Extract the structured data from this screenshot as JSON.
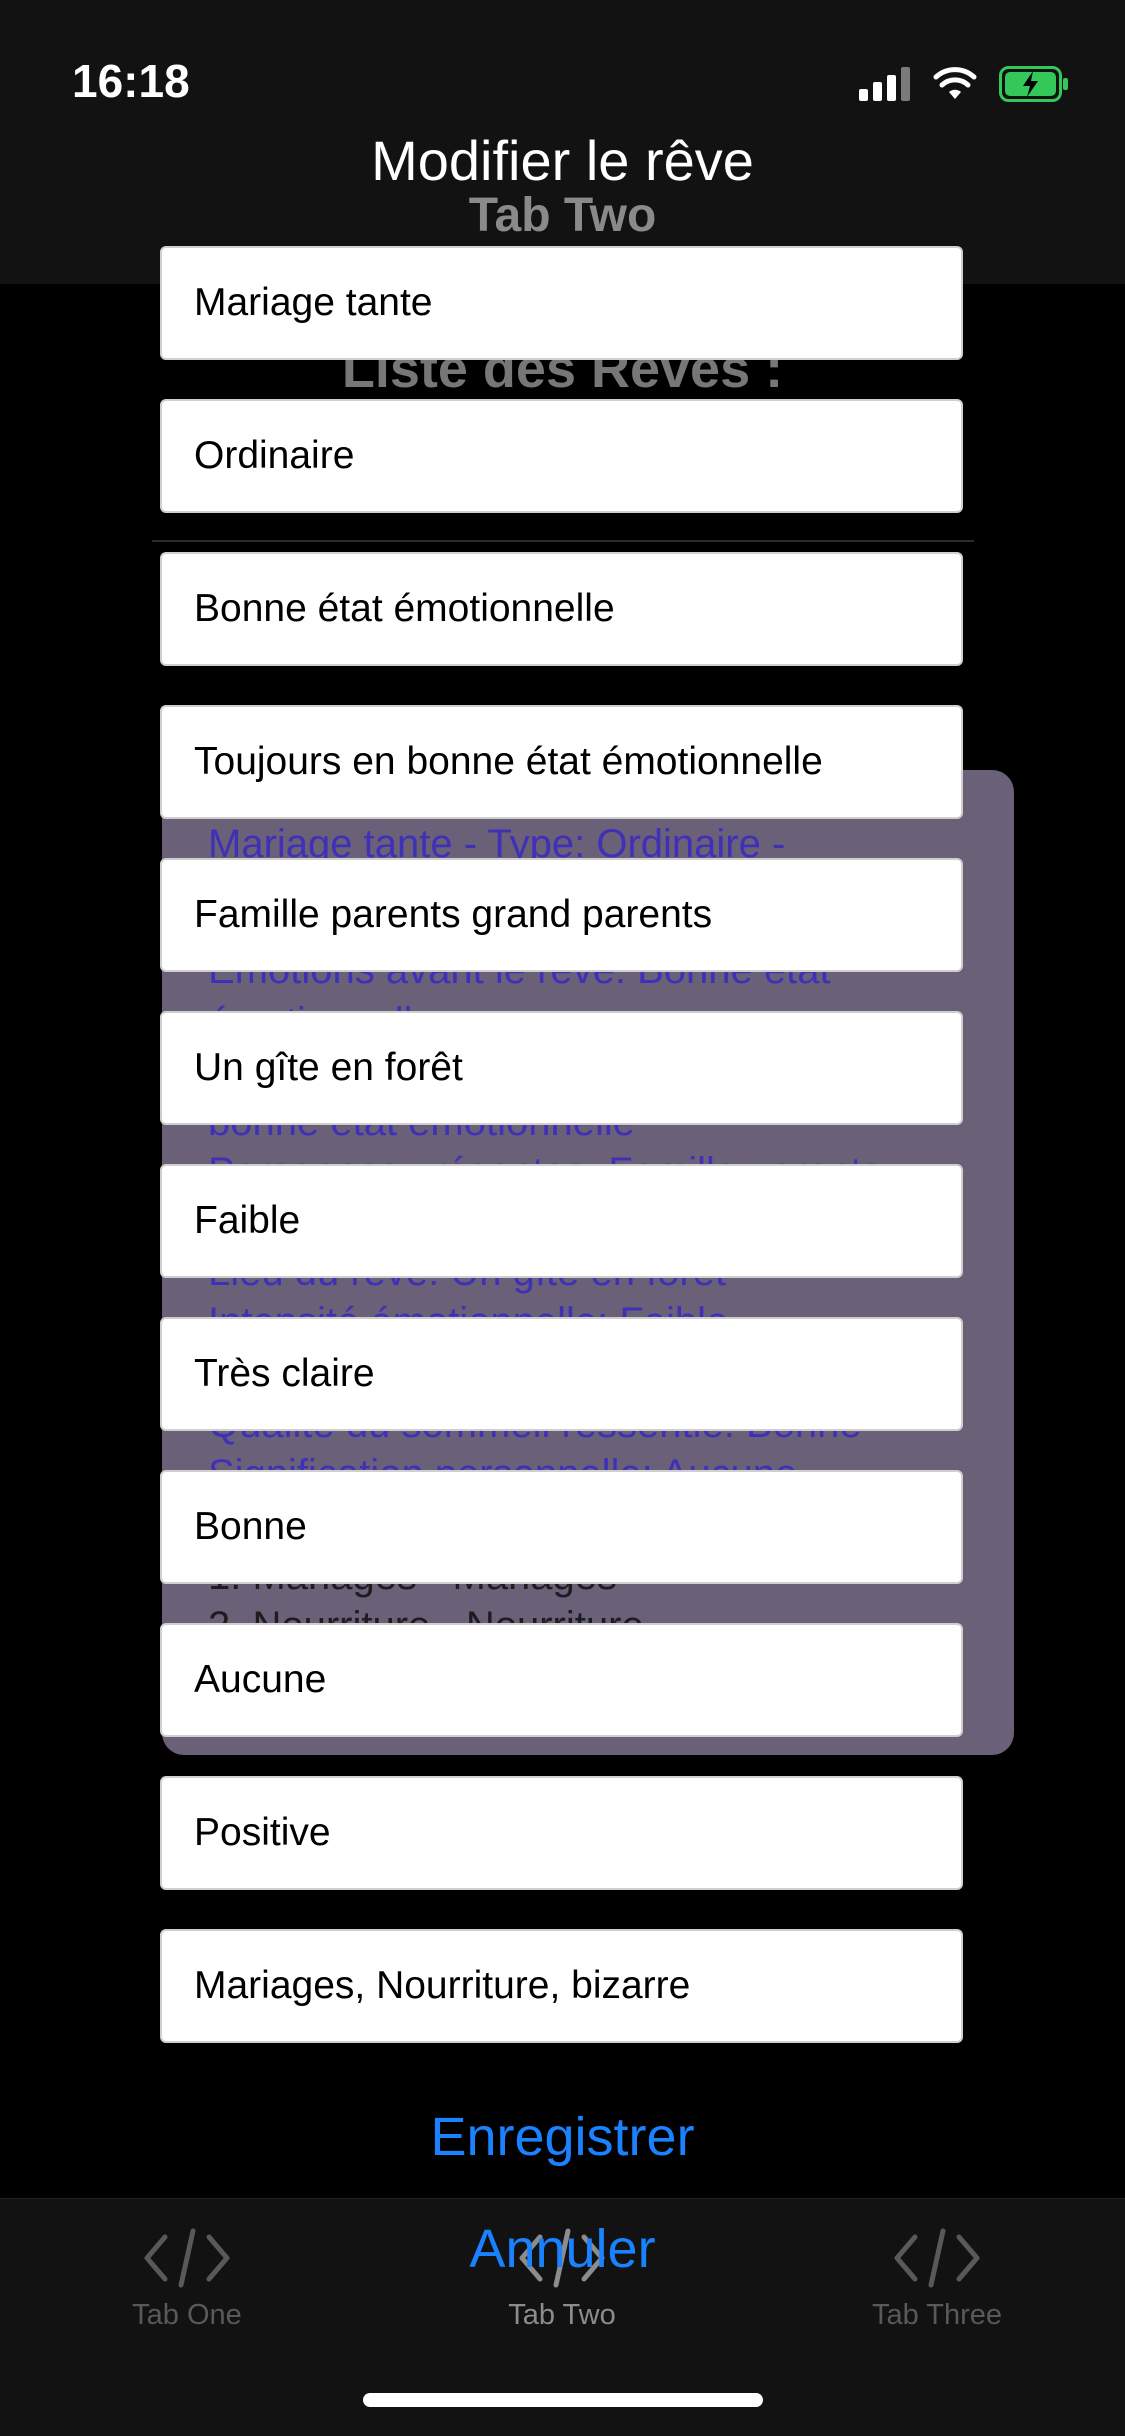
{
  "status_bar": {
    "time": "16:18"
  },
  "modal": {
    "title": "Modifier le rêve",
    "fields": [
      "Mariage tante",
      "Ordinaire",
      "Bonne état émotionnelle",
      "Toujours en bonne état émotionnelle",
      "Famille parents grand parents",
      "Un gîte en forêt",
      "Faible",
      "Très claire",
      "Bonne",
      "Aucune",
      "Positive",
      "Mariages, Nourriture, bizarre"
    ],
    "save_label": "Enregistrer",
    "cancel_label": "Annuler"
  },
  "background_page": {
    "nav_title": "Tab Two",
    "heading": "Liste des Rêves :",
    "card_lines": [
      "Mariage tante  - Type: Ordinaire -",
      "Émotions avant le rêve: Bonne état",
      "émotionnelle",
      "bonne état émotionnelle",
      "Personnes présentes: Famille parents",
      "Lieu du rêve: Un gîte en forêt",
      "Intensité émotionnelle: Faible",
      "Qualité du sommeil ressentie: Bonne",
      "Signification personnelle: Aucune",
      "1. Mariages - Mariages",
      "2. Nourriture - Nourriture"
    ]
  },
  "tab_bar": {
    "tabs": [
      {
        "label": "Tab One",
        "icon": "code-icon",
        "active": false
      },
      {
        "label": "Tab Two",
        "icon": "code-icon",
        "active": true
      },
      {
        "label": "Tab Three",
        "icon": "code-icon",
        "active": false
      }
    ]
  },
  "colors": {
    "accent": "#1a82ff",
    "card_background": "#6a6078",
    "card_text": "#3b2bc0",
    "battery_green": "#34c759"
  }
}
